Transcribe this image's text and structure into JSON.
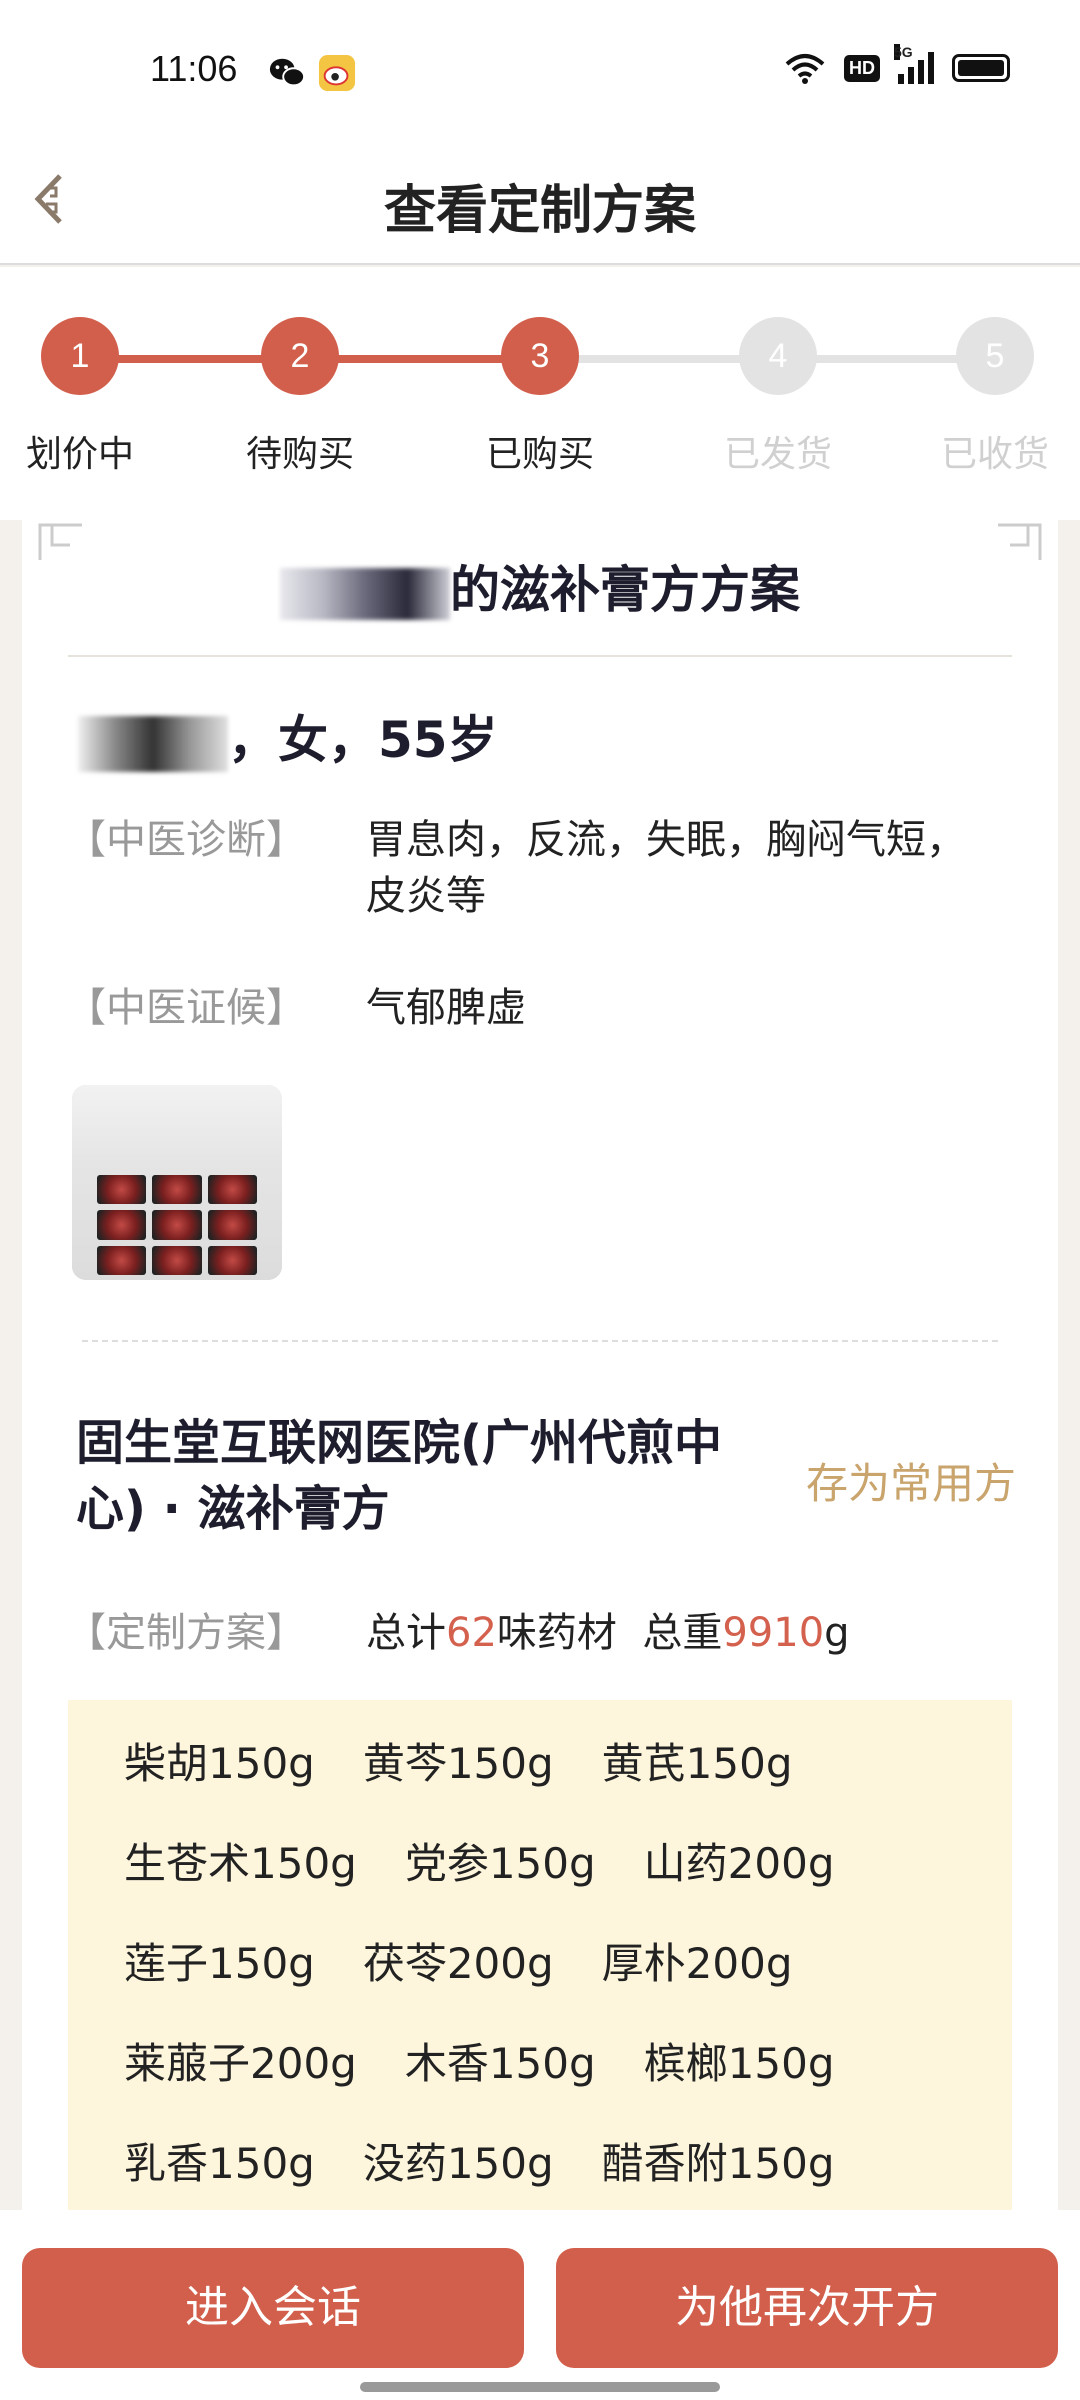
{
  "status_bar": {
    "time": "11:06",
    "hd": "HD",
    "network": "5G",
    "apps": [
      "wechat-icon",
      "weibo-icon"
    ]
  },
  "header": {
    "title": "查看定制方案"
  },
  "steps": {
    "items": [
      {
        "num": "1",
        "label": "划价中",
        "done": true
      },
      {
        "num": "2",
        "label": "待购买",
        "done": true
      },
      {
        "num": "3",
        "label": "已购买",
        "done": true
      },
      {
        "num": "4",
        "label": "已发货",
        "done": false
      },
      {
        "num": "5",
        "label": "已收货",
        "done": false
      }
    ],
    "active_color": "#d25f4c",
    "inactive_color": "#e3e3e3"
  },
  "card": {
    "title_suffix": "的滋补膏方方案",
    "patient_info": "，女，55岁",
    "diagnosis_label": "【中医诊断】",
    "diagnosis_value": "胃息肉，反流，失眠，胸闷气短，皮炎等",
    "syndrome_label": "【中医证候】",
    "syndrome_value": "气郁脾虚",
    "hospital": "固生堂互联网医院(广州代煎中心) · 滋补膏方",
    "save_as_common": "存为常用方",
    "plan_label": "【定制方案】",
    "plan_count_prefix": "总计",
    "plan_count": "62",
    "plan_count_suffix": "味药材",
    "plan_weight_prefix": "总重",
    "plan_weight": "9910",
    "plan_weight_unit": "g",
    "herb_rows": [
      [
        "柴胡150g",
        "黄芩150g",
        "黄芪150g"
      ],
      [
        "生苍术150g",
        "党参150g",
        "山药200g"
      ],
      [
        "莲子150g",
        "茯苓200g",
        "厚朴200g"
      ],
      [
        "莱菔子200g",
        "木香150g",
        "槟榔150g"
      ],
      [
        "乳香150g",
        "没药150g",
        "醋香附150g"
      ]
    ]
  },
  "actions": {
    "chat": "进入会话",
    "represcribe": "为他再次开方"
  }
}
